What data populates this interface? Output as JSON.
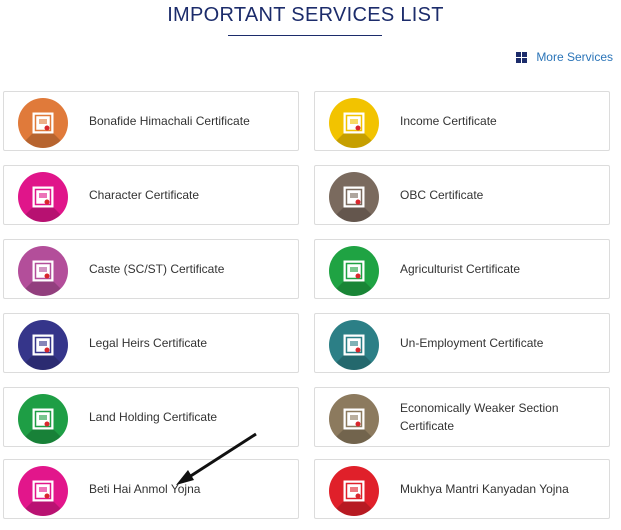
{
  "header": {
    "title": "IMPORTANT SERVICES LIST",
    "more_label": "More Services"
  },
  "services": [
    {
      "label": "Bonafide Himachali Certificate",
      "color": "#e07a3a"
    },
    {
      "label": "Income Certificate",
      "color": "#f2c300"
    },
    {
      "label": "Character Certificate",
      "color": "#e0158a"
    },
    {
      "label": "OBC Certificate",
      "color": "#7a6a5e"
    },
    {
      "label": "Caste (SC/ST) Certificate",
      "color": "#b34e9a"
    },
    {
      "label": "Agriculturist Certificate",
      "color": "#1fa343"
    },
    {
      "label": "Legal Heirs Certificate",
      "color": "#35358a"
    },
    {
      "label": "Un-Employment Certificate",
      "color": "#2c7f86"
    },
    {
      "label": "Land Holding Certificate",
      "color": "#1e9e45"
    },
    {
      "label": "Economically Weaker Section Certificate",
      "color": "#8c7a5e"
    },
    {
      "label": "Beti Hai Anmol Yojna",
      "color": "#e2168b"
    },
    {
      "label": "Mukhya Mantri Kanyadan Yojna",
      "color": "#e0202a"
    }
  ],
  "icons": {
    "more": "grid-icon",
    "service": "certificate-icon",
    "annotation": "arrow-icon"
  }
}
